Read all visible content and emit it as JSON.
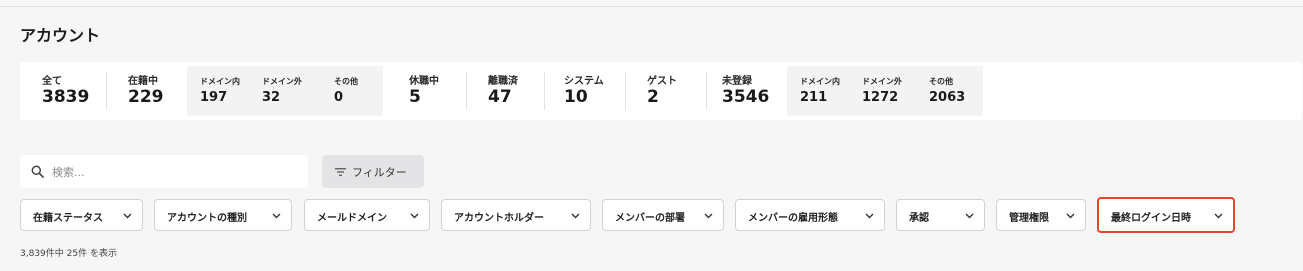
{
  "page": {
    "title": "アカウント"
  },
  "stats": {
    "all": {
      "label": "全て",
      "value": "3839"
    },
    "enrolled": {
      "label": "在籍中",
      "value": "229"
    },
    "enrolled_breakdown": [
      {
        "label": "ドメイン内",
        "value": "197"
      },
      {
        "label": "ドメイン外",
        "value": "32"
      },
      {
        "label": "その他",
        "value": "0"
      }
    ],
    "on_leave": {
      "label": "休職中",
      "value": "5"
    },
    "retired": {
      "label": "離職済",
      "value": "47"
    },
    "system": {
      "label": "システム",
      "value": "10"
    },
    "guest": {
      "label": "ゲスト",
      "value": "2"
    },
    "unregistered": {
      "label": "未登録",
      "value": "3546"
    },
    "unregistered_breakdown": [
      {
        "label": "ドメイン内",
        "value": "211"
      },
      {
        "label": "ドメイン外",
        "value": "1272"
      },
      {
        "label": "その他",
        "value": "2063"
      }
    ]
  },
  "search": {
    "placeholder": "検索...",
    "value": "",
    "icon": "search-icon"
  },
  "filter_button": {
    "label": "フィルター",
    "icon": "filter-lines-icon"
  },
  "filter_chips": [
    {
      "label": "在籍ステータス"
    },
    {
      "label": "アカウントの種別"
    },
    {
      "label": "メールドメイン"
    },
    {
      "label": "アカウントホルダー"
    },
    {
      "label": "メンバーの部署"
    },
    {
      "label": "メンバーの雇用形態"
    },
    {
      "label": "承認"
    },
    {
      "label": "管理権限"
    },
    {
      "label": "最終ログイン日時",
      "highlighted": true
    }
  ],
  "result_count": "3,839件中 25件 を表示",
  "colors": {
    "highlight_border": "#e8452a",
    "background": "#f6f6f7",
    "card": "#ffffff"
  }
}
